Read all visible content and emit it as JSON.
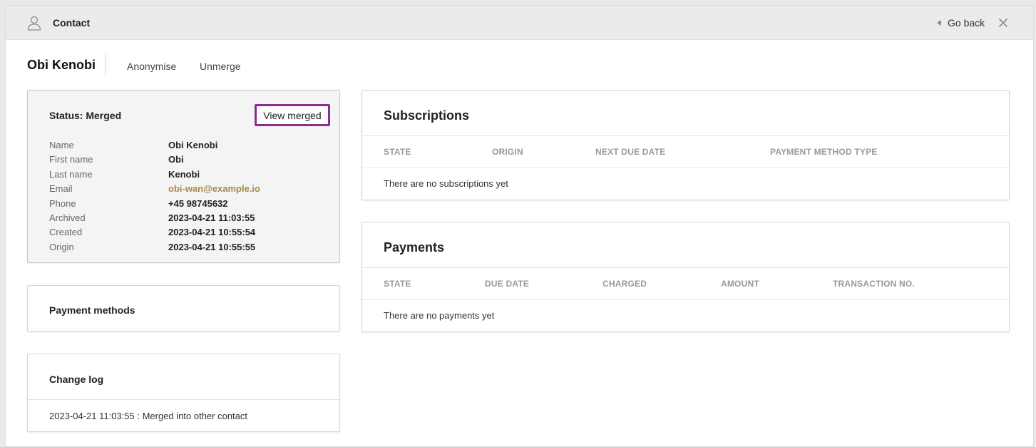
{
  "header": {
    "title": "Contact",
    "go_back": "Go back"
  },
  "contact": {
    "name": "Obi Kenobi",
    "actions": [
      "Anonymise",
      "Unmerge"
    ]
  },
  "status_card": {
    "title": "Status: Merged",
    "view_merged": "View merged",
    "fields": [
      {
        "label": "Name",
        "value": "Obi Kenobi"
      },
      {
        "label": "First name",
        "value": "Obi"
      },
      {
        "label": "Last name",
        "value": "Kenobi"
      },
      {
        "label": "Email",
        "value": "obi-wan@example.io"
      },
      {
        "label": "Phone",
        "value": "+45 98745632"
      },
      {
        "label": "Archived",
        "value": "2023-04-21 11:03:55"
      },
      {
        "label": "Created",
        "value": "2023-04-21 10:55:54"
      },
      {
        "label": "Origin",
        "value": "2023-04-21 10:55:55"
      }
    ]
  },
  "payment_methods": {
    "title": "Payment methods"
  },
  "change_log": {
    "title": "Change log",
    "entries": [
      "2023-04-21 11:03:55 : Merged into other contact"
    ]
  },
  "subscriptions": {
    "title": "Subscriptions",
    "columns": [
      "STATE",
      "ORIGIN",
      "NEXT DUE DATE",
      "PAYMENT METHOD TYPE"
    ],
    "empty": "There are no subscriptions yet"
  },
  "payments": {
    "title": "Payments",
    "columns": [
      "STATE",
      "DUE DATE",
      "CHARGED",
      "AMOUNT",
      "TRANSACTION NO."
    ],
    "empty": "There are no payments yet"
  },
  "colors": {
    "accent_outline": "#8e2a93",
    "email_link": "#a8894a"
  },
  "icons": {
    "header": "person-icon",
    "go_back": "triangle-left-icon",
    "close": "close-icon"
  }
}
